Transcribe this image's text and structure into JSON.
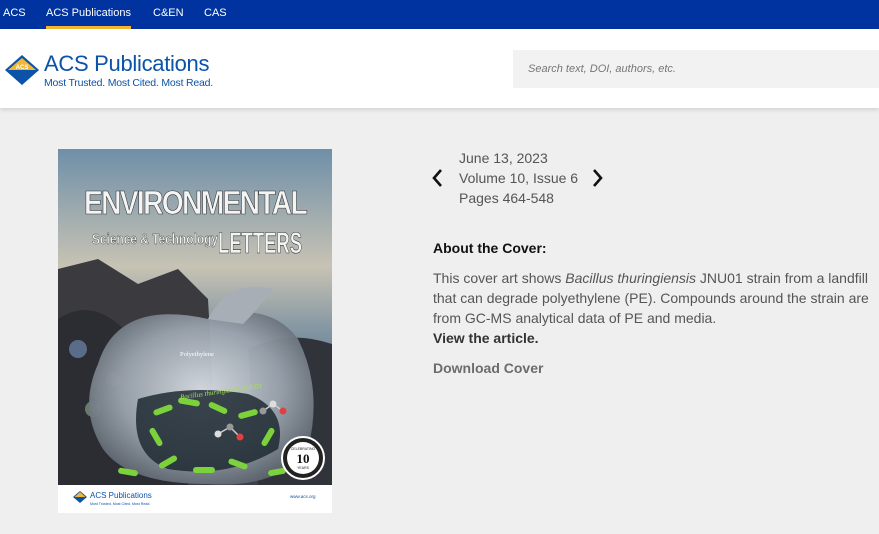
{
  "topnav": {
    "items": [
      {
        "label": "ACS",
        "active": false
      },
      {
        "label": "ACS Publications",
        "active": true
      },
      {
        "label": "C&EN",
        "active": false
      },
      {
        "label": "CAS",
        "active": false
      }
    ]
  },
  "header": {
    "logo_name": "ACS Publications",
    "logo_tagline": "Most Trusted. Most Cited. Most Read.",
    "search_placeholder": "Search text, DOI, authors, etc."
  },
  "issue": {
    "date": "June 13, 2023",
    "volume": "Volume 10, Issue 6",
    "pages": "Pages 464-548"
  },
  "about": {
    "heading": "About the Cover:",
    "text_prefix": "This cover art shows ",
    "text_italic": "Bacillus thuringiensis",
    "text_suffix": " JNU01 strain from a landfill that can degrade polyethylene (PE). Compounds around the strain are from GC-MS analytical data of PE and media.",
    "view_article": "View the article.",
    "download_cover": "Download Cover"
  },
  "cover": {
    "journal_line1": "ENVIRONMENTAL",
    "journal_line2": "Science & Technology",
    "journal_line3": "LETTERS",
    "bag_label": "Polyethylene",
    "bacteria_label": "Bacillus thuringiensis JNU01",
    "badge_top": "CELEBRATING",
    "badge_number": "10",
    "badge_bottom": "YEARS",
    "footer_logo": "ACS Publications",
    "footer_tagline": "Most Trusted. Most Cited. Most Read.",
    "footer_url": "www.acs.org"
  },
  "colors": {
    "topbar": "#0033a0",
    "active_underline": "#f2b632",
    "brand_blue": "#0a53a8"
  }
}
